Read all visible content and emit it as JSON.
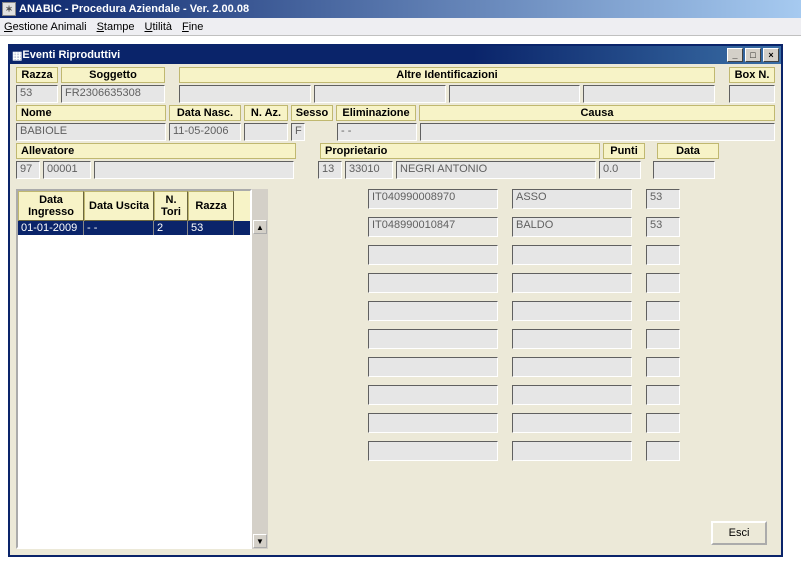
{
  "app": {
    "title": "ANABIC - Procedura Aziendale - Ver. 2.00.08"
  },
  "menu": {
    "gestione": "Gestione Animali",
    "stampe": "Stampe",
    "utilita": "Utilità",
    "fine": "Fine"
  },
  "mdi": {
    "title": "Eventi Riproduttivi"
  },
  "labels": {
    "razza": "Razza",
    "soggetto": "Soggetto",
    "altre_id": "Altre Identificazioni",
    "box_n": "Box N.",
    "nome": "Nome",
    "data_nasc": "Data Nasc.",
    "n_az": "N. Az.",
    "sesso": "Sesso",
    "eliminazione": "Eliminazione",
    "causa": "Causa",
    "allevatore": "Allevatore",
    "proprietario": "Proprietario",
    "punti": "Punti",
    "data": "Data"
  },
  "values": {
    "razza": "53",
    "soggetto": "FR2306635308",
    "altre_1": "",
    "altre_2": "",
    "altre_3": "",
    "altre_4": "",
    "box_n": "",
    "nome": "BABIOLE",
    "data_nasc": "11-05-2006",
    "n_az": "",
    "sesso": "F",
    "elim": "- -",
    "causa": "",
    "allev_cod1": "97",
    "allev_cod2": "00001",
    "allev_nome": "",
    "prop_cod1": "13",
    "prop_cod2": "33010",
    "prop_nome": "NEGRI ANTONIO",
    "punti": "0.0",
    "data": ""
  },
  "grid": {
    "headers": {
      "ingresso": "Data Ingresso",
      "uscita": "Data Uscita",
      "ntori": "N. Tori",
      "razza": "Razza"
    },
    "rows": [
      {
        "ingresso": "01-01-2009",
        "uscita": "- -",
        "ntori": "2",
        "razza": "53"
      }
    ]
  },
  "rightlist": {
    "rows": [
      {
        "code": "IT040990008970",
        "name": "ASSO",
        "rz": "53"
      },
      {
        "code": "IT048990010847",
        "name": "BALDO",
        "rz": "53"
      },
      {
        "code": "",
        "name": "",
        "rz": ""
      },
      {
        "code": "",
        "name": "",
        "rz": ""
      },
      {
        "code": "",
        "name": "",
        "rz": ""
      },
      {
        "code": "",
        "name": "",
        "rz": ""
      },
      {
        "code": "",
        "name": "",
        "rz": ""
      },
      {
        "code": "",
        "name": "",
        "rz": ""
      },
      {
        "code": "",
        "name": "",
        "rz": ""
      },
      {
        "code": "",
        "name": "",
        "rz": ""
      }
    ]
  },
  "buttons": {
    "esci": "Esci"
  }
}
